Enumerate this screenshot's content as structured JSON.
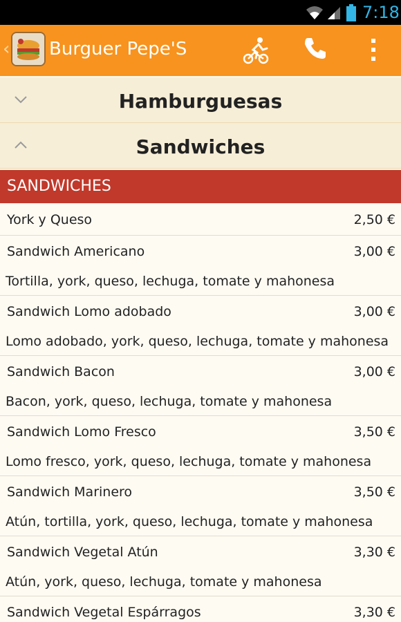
{
  "status_bar": {
    "time": "7:18",
    "icons": [
      "wifi-icon",
      "signal-icon",
      "battery-icon"
    ]
  },
  "action_bar": {
    "title": "Burguer Pepe'S",
    "icons": [
      "up-caret-icon",
      "restaurant-logo",
      "delivery-icon",
      "phone-icon",
      "overflow-menu-icon"
    ]
  },
  "groups": [
    {
      "label": "Hamburguesas",
      "state": "collapsed"
    },
    {
      "label": "Sandwiches",
      "state": "expanded"
    }
  ],
  "section": {
    "label": "SANDWICHES"
  },
  "items": [
    {
      "name": "York y Queso",
      "price": "2,50 €",
      "desc": ""
    },
    {
      "name": "Sandwich Americano",
      "price": "3,00 €",
      "desc": "Tortilla, york, queso, lechuga, tomate y mahonesa"
    },
    {
      "name": "Sandwich Lomo adobado",
      "price": "3,00 €",
      "desc": "Lomo adobado, york, queso, lechuga, tomate y mahonesa"
    },
    {
      "name": "Sandwich Bacon",
      "price": "3,00 €",
      "desc": "Bacon, york, queso, lechuga, tomate y mahonesa"
    },
    {
      "name": "Sandwich Lomo Fresco",
      "price": "3,50 €",
      "desc": "Lomo fresco, york, queso, lechuga, tomate y mahonesa"
    },
    {
      "name": "Sandwich Marinero",
      "price": "3,50 €",
      "desc": "Atún, tortilla, york, queso, lechuga, tomate y mahonesa"
    },
    {
      "name": "Sandwich Vegetal Atún",
      "price": "3,30 €",
      "desc": "Atún, york, queso, lechuga, tomate y mahonesa"
    },
    {
      "name": "Sandwich Vegetal Espárragos",
      "price": "3,30 €",
      "desc": ""
    }
  ],
  "colors": {
    "action_bar": "#f7931e",
    "section_band": "#c0392b",
    "status_text": "#33b5e5",
    "background": "#fdf7e8"
  }
}
